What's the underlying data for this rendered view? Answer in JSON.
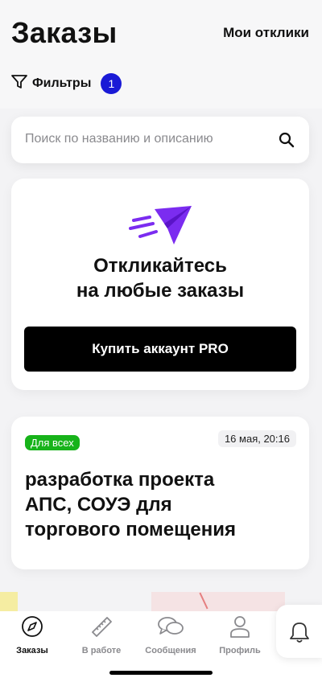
{
  "header": {
    "title": "Заказы",
    "my_replies": "Мои отклики",
    "filters_label": "Фильтры",
    "filters_count": "1"
  },
  "search": {
    "placeholder": "Поиск по названию и описанию"
  },
  "promo": {
    "title_line1": "Откликайтесь",
    "title_line2": "на любые заказы",
    "button_label": "Купить аккаунт PRO"
  },
  "order": {
    "tag": "Для всех",
    "date": "16 мая, 20:16",
    "title_line1": "разработка проекта",
    "title_line2": "АПС, СОУЭ для",
    "title_line3": "торгового помещения"
  },
  "tabs": [
    {
      "label": "Заказы",
      "icon": "compass-icon"
    },
    {
      "label": "В работе",
      "icon": "ruler-icon"
    },
    {
      "label": "Сообщения",
      "icon": "chat-icon"
    },
    {
      "label": "Профиль",
      "icon": "profile-icon"
    }
  ],
  "colors": {
    "accent": "#1a1ad6",
    "brand_purple": "#7b2cf0",
    "tag_green": "#17b31a"
  }
}
